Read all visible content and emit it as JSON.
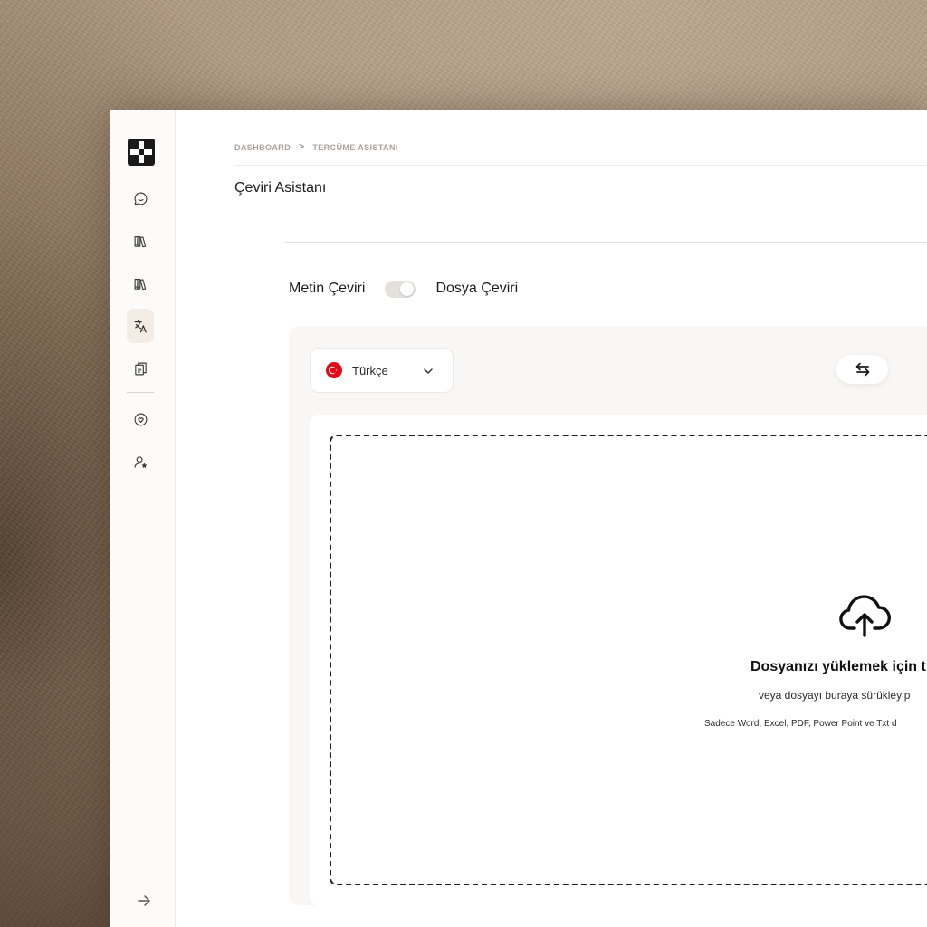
{
  "breadcrumb": {
    "items": [
      "DASHBOARD",
      "TERCÜME ASISTANI"
    ],
    "separator": ">"
  },
  "page": {
    "title": "Çeviri Asistanı"
  },
  "sidebar": {
    "items": [
      {
        "icon": "chat-icon",
        "active": false
      },
      {
        "icon": "library-icon",
        "active": false
      },
      {
        "icon": "library-icon",
        "active": false
      },
      {
        "icon": "translate-icon",
        "active": true
      },
      {
        "icon": "documents-icon",
        "active": false
      },
      {
        "icon": "heart-chat-icon",
        "active": false
      },
      {
        "icon": "user-star-icon",
        "active": false
      }
    ],
    "collapse_icon": "arrow-right-icon"
  },
  "mode": {
    "left_label": "Metin Çeviri",
    "right_label": "Dosya Çeviri",
    "selected": "Dosya Çeviri"
  },
  "language": {
    "selected": "Türkçe",
    "flag": "turkey-flag-icon"
  },
  "upload": {
    "title": "Dosyanızı yüklemek için t",
    "subtitle": "veya dosyayı buraya sürükleyip",
    "note": "Sadece Word, Excel, PDF, Power Point ve Txt d"
  },
  "colors": {
    "accent_active": "#f3ece5",
    "flag_red": "#e30a17",
    "text_primary": "#1d1d1d",
    "breadcrumb": "#a9a29b"
  }
}
